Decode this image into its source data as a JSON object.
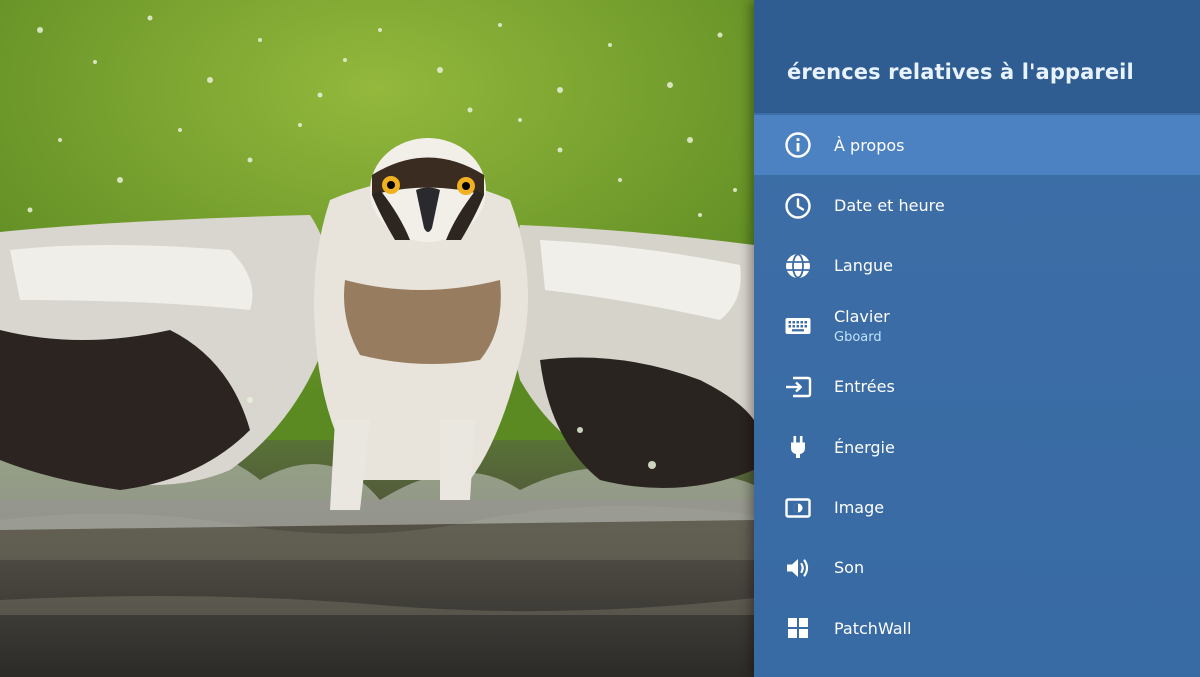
{
  "background": {
    "subject": "osprey-photo"
  },
  "settings_panel": {
    "title": "érences relatives à l'appareil",
    "items": [
      {
        "label": "À propos",
        "icon": "info-icon",
        "focused": true
      },
      {
        "label": "Date et heure",
        "icon": "clock-icon"
      },
      {
        "label": "Langue",
        "icon": "globe-icon"
      },
      {
        "label": "Clavier",
        "sublabel": "Gboard",
        "icon": "keyboard-icon"
      },
      {
        "label": "Entrées",
        "icon": "input-icon"
      },
      {
        "label": "Énergie",
        "icon": "power-plug-icon"
      },
      {
        "label": "Image",
        "icon": "picture-icon"
      },
      {
        "label": "Son",
        "icon": "speaker-icon"
      },
      {
        "label": "PatchWall",
        "icon": "patchwall-icon"
      }
    ]
  },
  "colors": {
    "panel_bg": "#3b6ca5",
    "header_bg": "#2f5c91",
    "focus_bg": "#4d82c2",
    "title_color": "#e8f3ff",
    "sublabel_color": "#bfe3ff"
  }
}
